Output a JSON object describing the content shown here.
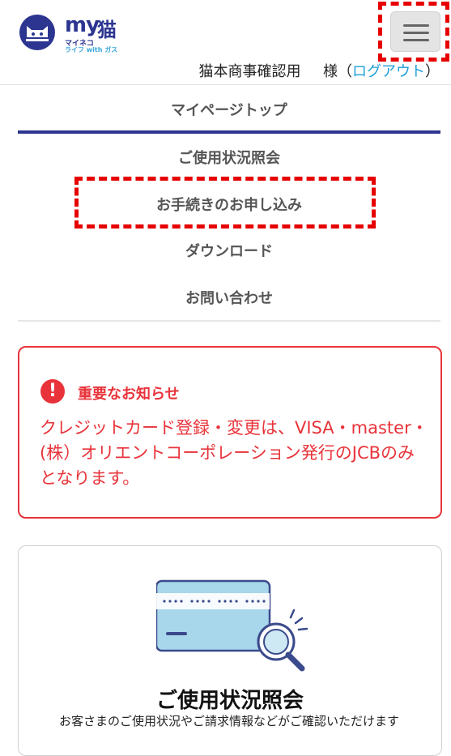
{
  "header": {
    "logo": {
      "my": "my",
      "kanji": "猫",
      "sub": "マイネコ",
      "tagline": "ライフ with ガス"
    },
    "menu_icon": "hamburger-icon",
    "user_name": "猫本商事確認用",
    "honorific": "様（",
    "logout_label": "ログアウト",
    "close_paren": "）"
  },
  "nav": {
    "items": [
      {
        "label": "マイページトップ"
      },
      {
        "label": "ご使用状況照会"
      },
      {
        "label": "お手続きのお申し込み"
      },
      {
        "label": "ダウンロード"
      },
      {
        "label": "お問い合わせ"
      }
    ]
  },
  "notice": {
    "icon": "exclamation-icon",
    "title": "重要なお知らせ",
    "body": "クレジットカード登録・変更は、VISA・master・(株）オリエントコーポレーション発行のJCBのみとなります。"
  },
  "card": {
    "icon": "credit-card-search-icon",
    "title": "ご使用状況照会",
    "description": "お客さまのご使用状況やご請求情報などがご確認いただけます"
  },
  "colors": {
    "brand": "#2c3590",
    "accent": "#1ea0d8",
    "alert": "#e8333a",
    "highlight": "#e60000"
  }
}
